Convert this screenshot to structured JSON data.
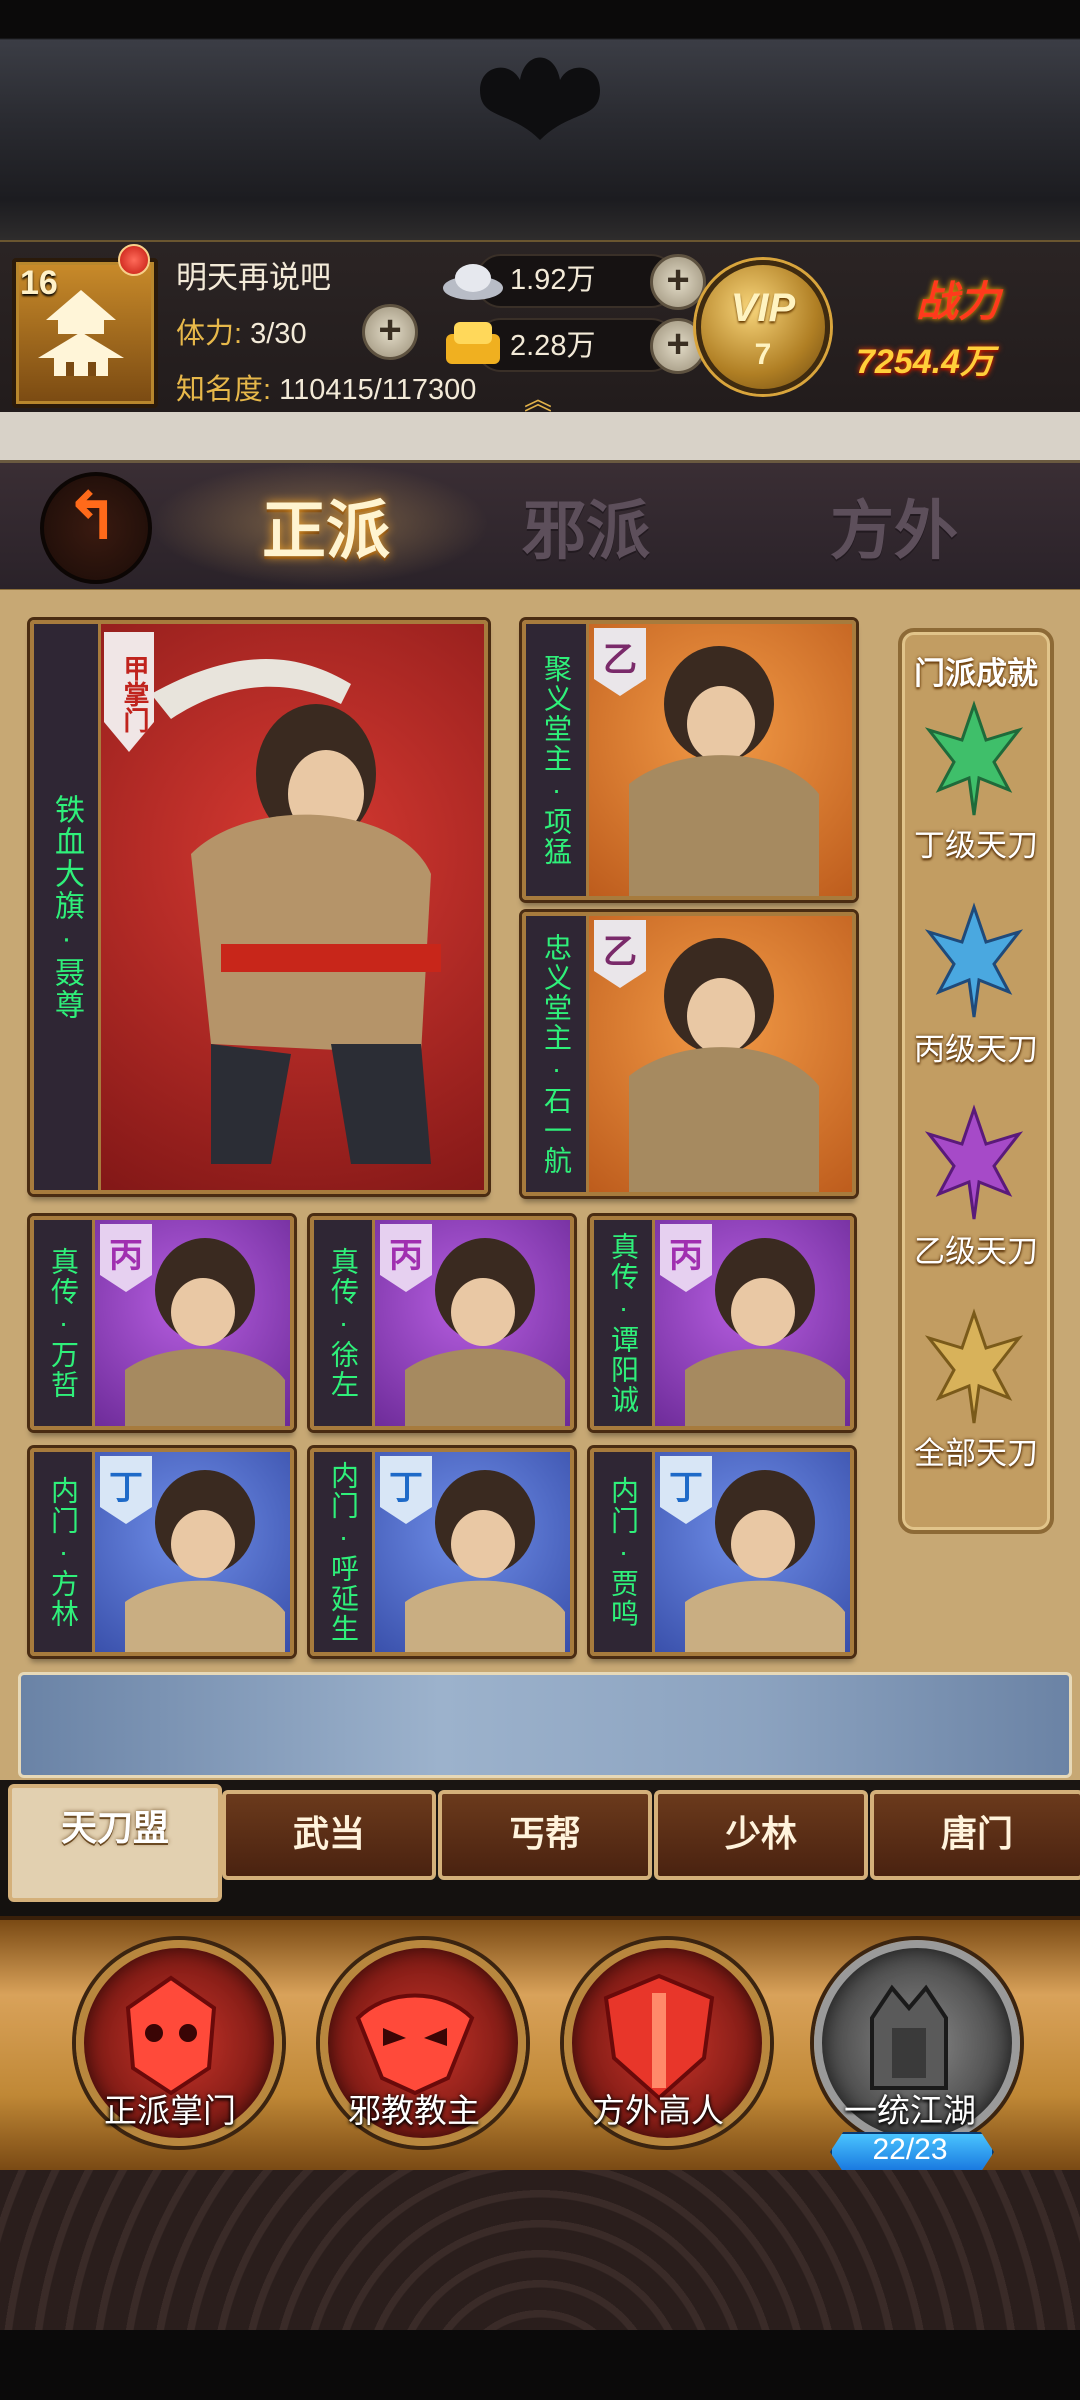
{
  "player": {
    "level": "16",
    "name": "明天再说吧",
    "stamina_label": "体力:",
    "stamina_value": "3/30",
    "fame_label": "知名度:",
    "fame_value": "110415/117300"
  },
  "resources": {
    "silver": "1.92万",
    "gold": "2.28万",
    "vip_label": "VIP",
    "vip_level": "7",
    "power_label": "战力",
    "power_value": "7254.4万"
  },
  "faction_tabs": [
    "正派",
    "邪派",
    "方外"
  ],
  "cards": {
    "leader": {
      "name": "铁血大旗·聂尊",
      "rank": "甲掌门"
    },
    "elder1": {
      "name": "聚义堂主·项猛",
      "rank": "乙"
    },
    "elder2": {
      "name": "忠义堂主·石一航",
      "rank": "乙"
    },
    "disciples_bing": [
      {
        "name": "真传·万哲",
        "rank": "丙"
      },
      {
        "name": "真传·徐左",
        "rank": "丙"
      },
      {
        "name": "真传·谭阳诚",
        "rank": "丙"
      }
    ],
    "disciples_ding": [
      {
        "name": "内门·方林",
        "rank": "丁"
      },
      {
        "name": "内门·呼延生",
        "rank": "丁"
      },
      {
        "name": "内门·贾鸣",
        "rank": "丁"
      }
    ]
  },
  "achievements": {
    "title": "门派成就",
    "items": [
      {
        "label": "丁级天刀",
        "icon": "green-blade-icon",
        "color": "#3fbf6a"
      },
      {
        "label": "丙级天刀",
        "icon": "blue-blade-icon",
        "color": "#4aa8e0"
      },
      {
        "label": "乙级天刀",
        "icon": "purple-blade-icon",
        "color": "#a64ac8"
      },
      {
        "label": "全部天刀",
        "icon": "gold-blade-icon",
        "color": "#d8b25a"
      }
    ]
  },
  "sect_tabs": [
    "天刀盟",
    "武当",
    "丐帮",
    "少林",
    "唐门"
  ],
  "rankings": [
    {
      "label": "正派掌门",
      "icon": "red-demon-mask-icon"
    },
    {
      "label": "邪教教主",
      "icon": "red-evil-mask-icon"
    },
    {
      "label": "方外高人",
      "icon": "red-shield-icon"
    },
    {
      "label": "一统江湖",
      "icon": "grey-throne-icon",
      "progress": "22/23"
    }
  ]
}
